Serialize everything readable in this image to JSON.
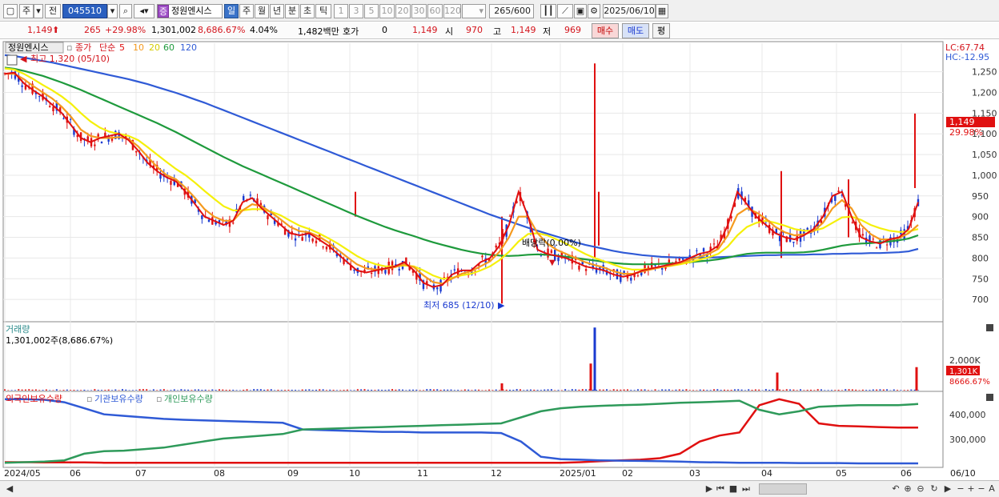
{
  "toolbar": {
    "period_label": "주",
    "prev_label": "전",
    "code": "045510",
    "name": "정원엔시스",
    "name_badge": "증",
    "tabs": [
      "일",
      "주",
      "월",
      "년",
      "분",
      "초",
      "틱"
    ],
    "active_tab": "일",
    "periods": [
      "1",
      "3",
      "5",
      "10",
      "20",
      "30",
      "60",
      "120"
    ],
    "count": "265",
    "count_total": "/600",
    "date": "2025/06/10"
  },
  "quote": {
    "price": "1,149",
    "change": "265",
    "change_pct": "+29.98%",
    "volume": "1,301,002",
    "volume_pct": "8,686.67%",
    "turnover": "4.04%",
    "amount": "1,482백만",
    "hoga_label": "호가",
    "hoga_value": "0",
    "hoga_price": "1,149",
    "open_label": "시",
    "open": "970",
    "high_label": "고",
    "high": "1,149",
    "low_label": "저",
    "low": "969",
    "buy_label": "매수",
    "sell_label": "매도",
    "avg_label": "평"
  },
  "colors": {
    "ma5": "#e01010",
    "ma10": "#f59a1e",
    "ma20": "#f5f00a",
    "ma60": "#1e9a3c",
    "ma120": "#2f5ad6",
    "up": "#e01010",
    "down": "#1a3ad0",
    "foreign": "#e01010",
    "institution": "#2f5ad6",
    "individual": "#2e9a5a"
  },
  "chart_data": [
    {
      "type": "line",
      "title": "정원엔시스",
      "legend": [
        "종가",
        "단순",
        "5",
        "10",
        "20",
        "60",
        "120"
      ],
      "x_labels": [
        "2024/05",
        "06",
        "07",
        "08",
        "09",
        "10",
        "11",
        "12",
        "2025/01",
        "02",
        "03",
        "04",
        "05",
        "06",
        "06/10"
      ],
      "y_ticks": [
        1250,
        1200,
        1150,
        1100,
        1050,
        1000,
        950,
        900,
        850,
        800,
        750,
        700
      ],
      "ylim": [
        650,
        1315
      ],
      "lc_label": "LC:67.74",
      "hc_label": "HC:-12.95",
      "last_label": "1,149",
      "last_pct": "29.98%",
      "annotations": {
        "high": "최고 1,320 (05/10)",
        "low": "최저 685 (12/10)",
        "dividend": "배당락(0.00%)"
      },
      "series": [
        {
          "key": "ma5",
          "values": [
            1245,
            1248,
            1222,
            1205,
            1190,
            1170,
            1150,
            1120,
            1090,
            1080,
            1090,
            1095,
            1100,
            1085,
            1060,
            1030,
            1010,
            995,
            985,
            960,
            930,
            900,
            890,
            880,
            890,
            935,
            945,
            920,
            900,
            880,
            860,
            855,
            860,
            845,
            830,
            810,
            790,
            770,
            765,
            770,
            775,
            780,
            790,
            770,
            740,
            730,
            735,
            760,
            770,
            770,
            790,
            800,
            830,
            880,
            960,
            900,
            820,
            810,
            805,
            800,
            790,
            780,
            775,
            770,
            760,
            755,
            760,
            770,
            775,
            780,
            785,
            790,
            800,
            810,
            815,
            830,
            880,
            960,
            930,
            900,
            880,
            860,
            850,
            845,
            855,
            870,
            900,
            950,
            960,
            900,
            850,
            840,
            835,
            845,
            850,
            870,
            935
          ]
        },
        {
          "key": "ma10",
          "values": [
            1245,
            1245,
            1232,
            1215,
            1200,
            1185,
            1165,
            1140,
            1110,
            1095,
            1090,
            1090,
            1092,
            1088,
            1070,
            1045,
            1020,
            1000,
            990,
            970,
            945,
            918,
            900,
            890,
            890,
            915,
            930,
            925,
            910,
            893,
            875,
            865,
            862,
            852,
            838,
            820,
            802,
            785,
            775,
            772,
            774,
            778,
            785,
            778,
            758,
            742,
            738,
            750,
            762,
            768,
            780,
            792,
            815,
            850,
            900,
            900,
            860,
            835,
            820,
            810,
            800,
            790,
            783,
            777,
            768,
            762,
            762,
            768,
            773,
            778,
            782,
            788,
            795,
            803,
            810,
            822,
            855,
            905,
            920,
            910,
            895,
            875,
            862,
            855,
            857,
            865,
            885,
            920,
            940,
            920,
            880,
            858,
            845,
            845,
            848,
            860,
            880
          ]
        },
        {
          "key": "ma20",
          "values": [
            1258,
            1255,
            1245,
            1232,
            1218,
            1205,
            1190,
            1172,
            1150,
            1130,
            1115,
            1105,
            1100,
            1095,
            1085,
            1068,
            1050,
            1032,
            1015,
            1000,
            982,
            962,
            943,
            925,
            915,
            915,
            918,
            918,
            912,
            903,
            890,
            878,
            870,
            860,
            848,
            835,
            820,
            805,
            793,
            785,
            780,
            780,
            782,
            780,
            770,
            758,
            750,
            752,
            758,
            762,
            770,
            780,
            795,
            815,
            840,
            858,
            860,
            855,
            845,
            835,
            822,
            810,
            800,
            792,
            784,
            776,
            772,
            772,
            775,
            778,
            781,
            785,
            790,
            796,
            802,
            810,
            828,
            855,
            875,
            885,
            890,
            885,
            878,
            870,
            866,
            866,
            872,
            885,
            898,
            900,
            892,
            880,
            872,
            866,
            863,
            864,
            870
          ]
        },
        {
          "key": "ma60",
          "values": [
            1260,
            1257,
            1252,
            1246,
            1240,
            1232,
            1224,
            1215,
            1206,
            1196,
            1186,
            1176,
            1166,
            1156,
            1146,
            1136,
            1126,
            1115,
            1104,
            1092,
            1080,
            1068,
            1056,
            1044,
            1033,
            1022,
            1012,
            1002,
            992,
            982,
            972,
            962,
            952,
            942,
            932,
            922,
            912,
            902,
            893,
            884,
            875,
            867,
            860,
            853,
            845,
            838,
            832,
            826,
            820,
            815,
            811,
            808,
            806,
            805,
            806,
            808,
            809,
            808,
            806,
            803,
            800,
            797,
            794,
            791,
            788,
            786,
            785,
            785,
            785,
            786,
            787,
            788,
            790,
            792,
            794,
            797,
            801,
            806,
            810,
            812,
            813,
            813,
            813,
            813,
            814,
            816,
            820,
            825,
            830,
            833,
            835,
            836,
            838,
            840,
            843,
            847,
            855
          ]
        },
        {
          "key": "ma120",
          "values": [
            1290,
            1288,
            1284,
            1280,
            1276,
            1272,
            1267,
            1262,
            1257,
            1252,
            1247,
            1242,
            1237,
            1232,
            1226,
            1220,
            1213,
            1206,
            1199,
            1191,
            1183,
            1175,
            1166,
            1157,
            1148,
            1139,
            1130,
            1121,
            1112,
            1103,
            1094,
            1085,
            1076,
            1067,
            1058,
            1049,
            1040,
            1031,
            1022,
            1013,
            1004,
            995,
            986,
            977,
            968,
            959,
            950,
            941,
            932,
            923,
            914,
            905,
            897,
            889,
            881,
            873,
            866,
            859,
            852,
            845,
            838,
            832,
            827,
            822,
            817,
            813,
            810,
            807,
            805,
            803,
            802,
            801,
            801,
            801,
            801,
            802,
            803,
            804,
            805,
            806,
            807,
            807,
            808,
            808,
            808,
            809,
            809,
            810,
            810,
            811,
            811,
            812,
            812,
            813,
            814,
            816,
            822
          ]
        }
      ]
    },
    {
      "type": "bar",
      "title": "거래량",
      "value_label": "1,301,002주(8,686.67%)",
      "y_ticks": [
        "2,000K"
      ],
      "last_label": "1,301K",
      "last_pct": "8666.67%",
      "spikes": [
        {
          "x": "12",
          "value": 400
        },
        {
          "x": "2025/01",
          "value": 1500
        },
        {
          "x": "2025/01",
          "value": 3500
        },
        {
          "x": "04",
          "value": 1000
        },
        {
          "x": "06/10",
          "value": 1301
        }
      ],
      "ylim": [
        0,
        3600
      ]
    },
    {
      "type": "line",
      "legend": [
        "외국인보유수량",
        "기관보유수량",
        "개인보유수량"
      ],
      "y_ticks": [
        "400,000",
        "300,000"
      ],
      "ylim": [
        220000,
        450000
      ],
      "series": [
        {
          "name": "외국인보유수량",
          "key": "foreign",
          "values": [
            232000,
            232000,
            231000,
            231000,
            231000,
            230000,
            230000,
            230000,
            230000,
            230000,
            230000,
            230000,
            230000,
            230000,
            230000,
            230000,
            230000,
            230000,
            230000,
            230000,
            230000,
            230000,
            230000,
            230000,
            230000,
            230000,
            230000,
            230000,
            230000,
            232000,
            235000,
            238000,
            240000,
            245000,
            260000,
            300000,
            320000,
            330000,
            420000,
            440000,
            425000,
            360000,
            352000,
            350000,
            348000,
            346000,
            346000
          ]
        },
        {
          "name": "기관보유수량",
          "key": "institution",
          "values": [
            440000,
            440000,
            438000,
            430000,
            410000,
            390000,
            385000,
            380000,
            375000,
            372000,
            370000,
            368000,
            366000,
            364000,
            362000,
            340000,
            338000,
            336000,
            334000,
            332000,
            332000,
            330000,
            330000,
            330000,
            330000,
            328000,
            300000,
            250000,
            242000,
            240000,
            238000,
            237000,
            236000,
            235000,
            234000,
            232000,
            231000,
            230000,
            230000,
            230000,
            229000,
            229000,
            229000,
            228000,
            228000,
            228000,
            228000
          ]
        },
        {
          "name": "개인보유수량",
          "key": "individual",
          "values": [
            230000,
            232000,
            234000,
            238000,
            260000,
            268000,
            270000,
            275000,
            280000,
            290000,
            300000,
            310000,
            315000,
            320000,
            325000,
            340000,
            342000,
            344000,
            346000,
            348000,
            350000,
            352000,
            354000,
            356000,
            358000,
            360000,
            380000,
            400000,
            410000,
            415000,
            418000,
            420000,
            422000,
            425000,
            428000,
            430000,
            432000,
            435000,
            405000,
            390000,
            400000,
            415000,
            418000,
            420000,
            420000,
            420000,
            424000
          ]
        }
      ]
    }
  ]
}
